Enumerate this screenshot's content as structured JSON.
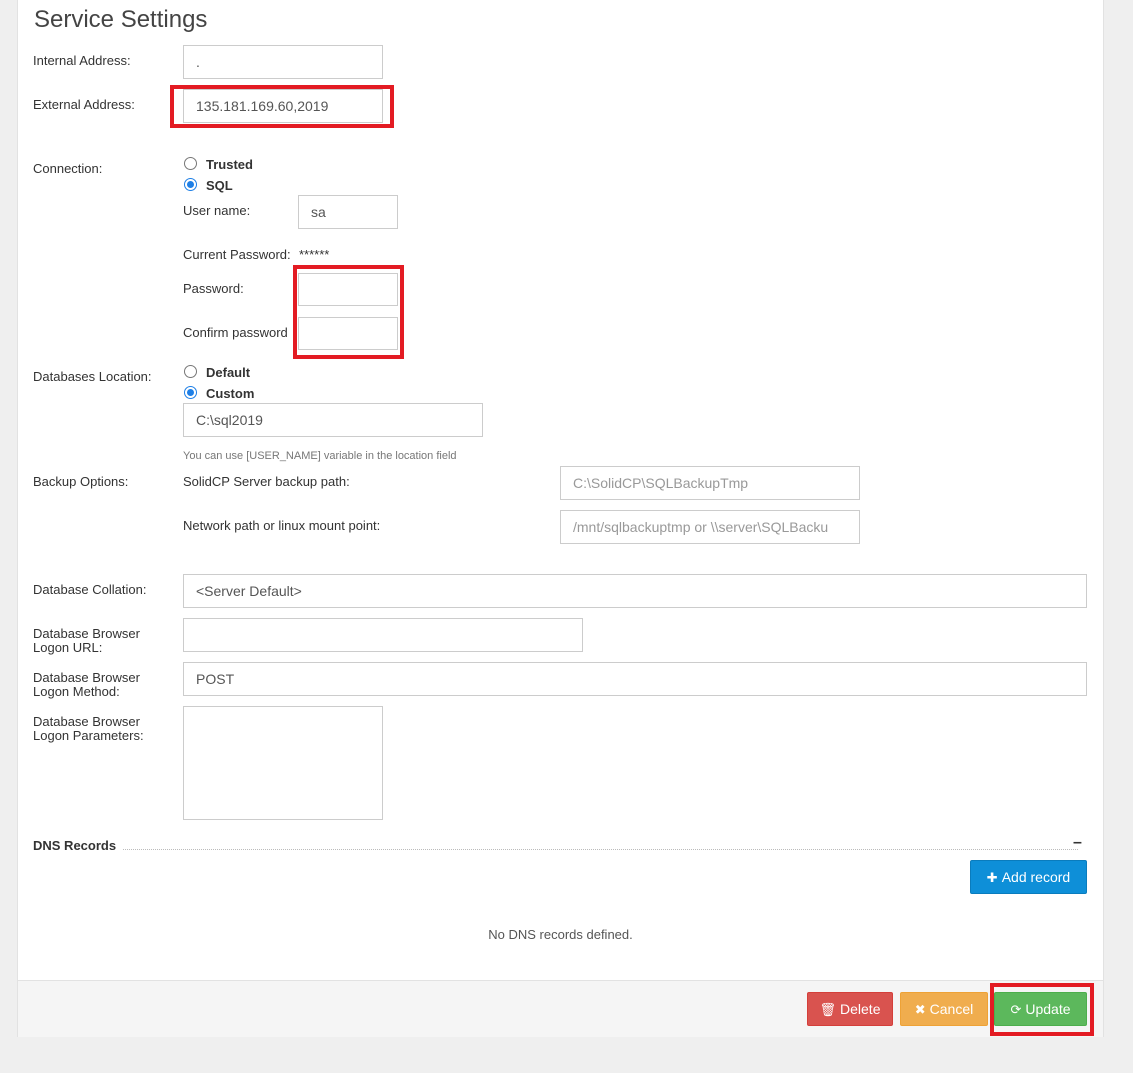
{
  "page": {
    "title": "Service Settings"
  },
  "internal_address": {
    "label": "Internal Address:",
    "value": "."
  },
  "external_address": {
    "label": "External Address:",
    "value": "135.181.169.60,2019"
  },
  "connection": {
    "label": "Connection:",
    "options": [
      {
        "label": "Trusted",
        "checked": false
      },
      {
        "label": "SQL",
        "checked": true
      }
    ],
    "username_label": "User name:",
    "username_value": "sa",
    "current_password_label": "Current Password:",
    "current_password_value": "******",
    "password_label": "Password:",
    "confirm_password_label": "Confirm password"
  },
  "databases_location": {
    "label": "Databases Location:",
    "options": [
      {
        "label": "Default",
        "checked": false
      },
      {
        "label": "Custom",
        "checked": true
      }
    ],
    "path_value": "C:\\sql2019",
    "hint": "You can use [USER_NAME] variable in the location field"
  },
  "backup_options": {
    "label": "Backup Options:",
    "server_path_label": "SolidCP Server backup path:",
    "server_path_value": "C:\\SolidCP\\SQLBackupTmp",
    "network_path_label": "Network path or linux mount point:",
    "network_path_placeholder": "/mnt/sqlbackuptmp or \\\\server\\SQLBacku"
  },
  "database_collation": {
    "label": "Database Collation:",
    "value": "<Server Default>"
  },
  "db_browser_logon_url": {
    "label": "Database Browser Logon URL:",
    "value": ""
  },
  "db_browser_logon_method": {
    "label": "Database Browser Logon Method:",
    "value": "POST"
  },
  "db_browser_logon_params": {
    "label": "Database Browser Logon Parameters:",
    "value": ""
  },
  "dns_records": {
    "title": "DNS Records",
    "collapse_symbol": "–",
    "add_label": "Add record",
    "empty_text": "No DNS records defined."
  },
  "footer": {
    "delete_label": "Delete",
    "cancel_label": "Cancel",
    "update_label": "Update"
  },
  "colors": {
    "highlight": "#e31b23",
    "primary_blue": "#0e8fd8",
    "danger": "#d9534f",
    "warning": "#f0ad4e",
    "success": "#5cb85c",
    "radio_checked": "#1e7fe6"
  }
}
